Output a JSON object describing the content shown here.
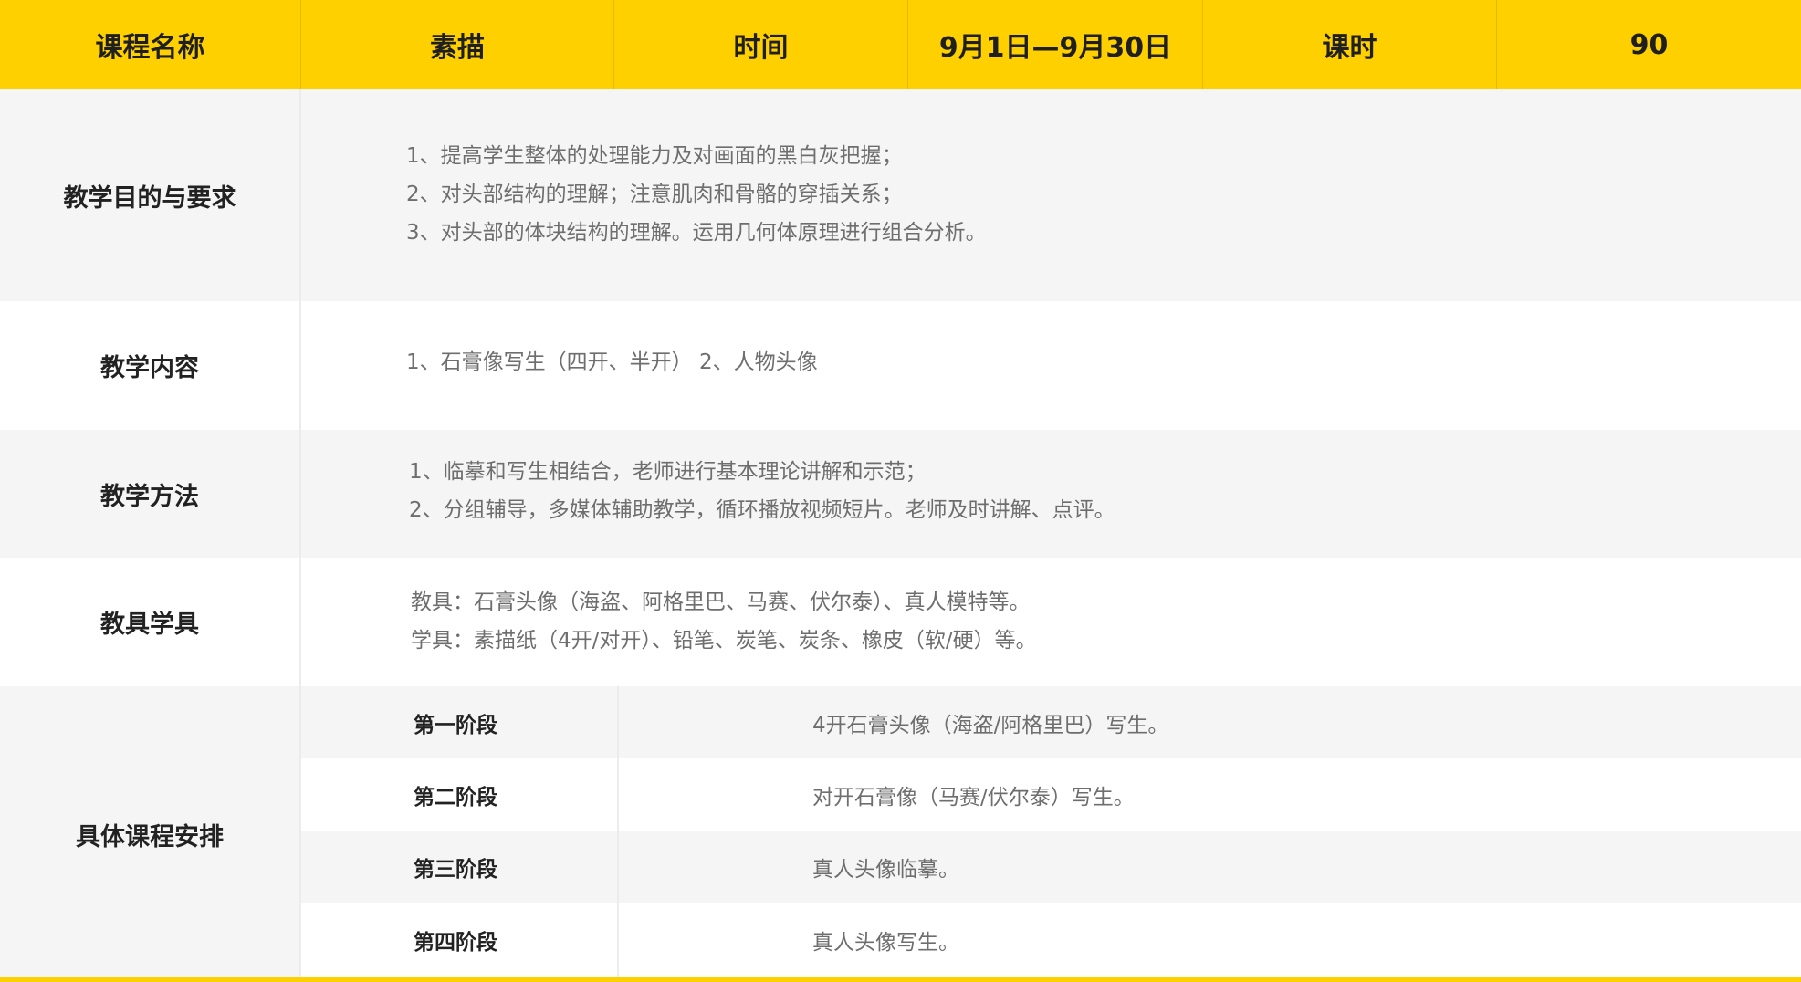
{
  "header": {
    "course_name_label": "课程名称",
    "course_name_value": "素描",
    "time_label": "时间",
    "time_value": "9月1日—9月30日",
    "hours_label": "课时",
    "hours_value": "90"
  },
  "objectives": {
    "label": "教学目的与要求",
    "lines": [
      "1、提高学生整体的处理能力及对画面的黑白灰把握；",
      "2、对头部结构的理解；注意肌肉和骨骼的穿插关系；",
      "3、对头部的体块结构的理解。运用几何体原理进行组合分析。"
    ]
  },
  "content": {
    "label": "教学内容",
    "lines": [
      "1、石膏像写生（四开、半开） 2、人物头像"
    ]
  },
  "methods": {
    "label": "教学方法",
    "lines": [
      "1、临摹和写生相结合，老师进行基本理论讲解和示范；",
      "2、分组辅导，多媒体辅助教学，循环播放视频短片。老师及时讲解、点评。"
    ]
  },
  "tools": {
    "label": "教具学具",
    "lines": [
      "教具：石膏头像（海盗、阿格里巴、马赛、伏尔泰）、真人模特等。",
      "学具：素描纸（4开/对开）、铅笔、炭笔、炭条、橡皮（软/硬）等。"
    ]
  },
  "schedule": {
    "label": "具体课程安排",
    "stages": [
      {
        "name": "第一阶段",
        "desc": "4开石膏头像（海盗/阿格里巴）写生。"
      },
      {
        "name": "第二阶段",
        "desc": "对开石膏像（马赛/伏尔泰）写生。"
      },
      {
        "name": "第三阶段",
        "desc": "真人头像临摹。"
      },
      {
        "name": "第四阶段",
        "desc": "真人头像写生。"
      }
    ]
  },
  "colors": {
    "header_bg": "#FFD000",
    "row_grey": "#f5f5f5",
    "muted_text": "#6e6e6e"
  }
}
